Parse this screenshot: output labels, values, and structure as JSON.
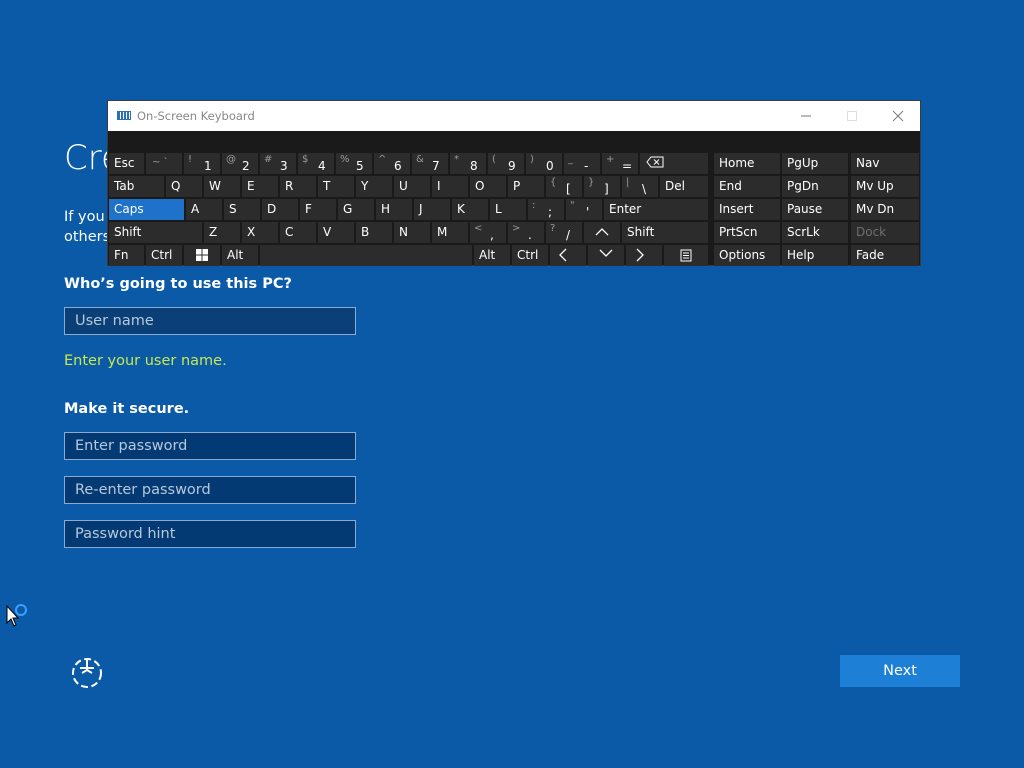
{
  "colors": {
    "background": "#0a5aa8",
    "accent_button": "#1e7fd6",
    "hint_text": "#c8e84e",
    "keyboard_bg": "#1a1a1a",
    "key_bg": "#2c2c2c",
    "key_active": "#1e72c9"
  },
  "page": {
    "title": "Cre",
    "description_line1": "If you v",
    "description_line2": "others"
  },
  "form": {
    "user_label": "Who’s going to use this PC?",
    "username_placeholder": "User name",
    "username_hint": "Enter your user name.",
    "secure_label": "Make it secure.",
    "password_placeholder": "Enter password",
    "reenter_placeholder": "Re-enter password",
    "hint_placeholder": "Password hint"
  },
  "buttons": {
    "next": "Next",
    "accessibility_icon": "ease-of-access-icon"
  },
  "osk": {
    "title": "On-Screen Keyboard",
    "row1": {
      "esc": "Esc",
      "backtick_shift": "~ `",
      "k1_shift": "!",
      "k1": "1",
      "k2_shift": "@",
      "k2": "2",
      "k3_shift": "#",
      "k3": "3",
      "k4_shift": "$",
      "k4": "4",
      "k5_shift": "%",
      "k5": "5",
      "k6_shift": "^",
      "k6": "6",
      "k7_shift": "&",
      "k7": "7",
      "k8_shift": "*",
      "k8": "8",
      "k9_shift": "(",
      "k9": "9",
      "k0_shift": ")",
      "k0": "0",
      "minus_shift": "_",
      "minus": "-",
      "equals_shift": "+",
      "equals": "=",
      "backspace_icon": "backspace-icon"
    },
    "row2": {
      "tab": "Tab",
      "q": "Q",
      "w": "W",
      "e": "E",
      "r": "R",
      "t": "T",
      "y": "Y",
      "u": "U",
      "i": "I",
      "o": "O",
      "p": "P",
      "lbrace": "{",
      "lbracket": "[",
      "rbrace": "}",
      "rbracket": "]",
      "pipe": "|",
      "backslash": "\\",
      "del": "Del"
    },
    "row3": {
      "caps": "Caps",
      "a": "A",
      "s": "S",
      "d": "D",
      "f": "F",
      "g": "G",
      "h": "H",
      "j": "J",
      "k": "K",
      "l": "L",
      "colon": ":",
      "semicolon": ";",
      "quote_shift": "\"",
      "quote": "'",
      "enter": "Enter"
    },
    "row4": {
      "shift_left": "Shift",
      "z": "Z",
      "x": "X",
      "c": "C",
      "v": "V",
      "b": "B",
      "n": "N",
      "m": "M",
      "lt": "<",
      "comma": ",",
      "gt": ">",
      "period": ".",
      "question": "?",
      "slash": "/",
      "shift_right": "Shift"
    },
    "row5": {
      "fn": "Fn",
      "ctrl_left": "Ctrl",
      "alt_left": "Alt",
      "alt_right": "Alt",
      "ctrl_right": "Ctrl"
    },
    "nav": {
      "home": "Home",
      "pgup": "PgUp",
      "nav": "Nav",
      "end": "End",
      "pgdn": "PgDn",
      "mvup": "Mv Up",
      "insert": "Insert",
      "pause": "Pause",
      "mvdn": "Mv Dn",
      "prtscn": "PrtScn",
      "scrlk": "ScrLk",
      "dock": "Dock",
      "options": "Options",
      "help": "Help",
      "fade": "Fade"
    }
  }
}
